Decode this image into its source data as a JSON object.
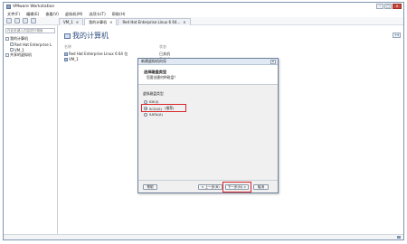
{
  "app": {
    "title": "VMware Workstation"
  },
  "window_controls": {
    "minimize": "–",
    "maximize": "□",
    "close": "x"
  },
  "menu": {
    "items": [
      "文件(F)",
      "编辑(E)",
      "查看(V)",
      "虚拟机(M)",
      "选项卡(T)",
      "帮助(H)"
    ]
  },
  "sidebar": {
    "search_placeholder": "在此处键入内容进行搜索",
    "tree": [
      {
        "label": "我的计算机",
        "level": 0
      },
      {
        "label": "Red Hat Enterprise L",
        "level": 1
      },
      {
        "label": "VM_1",
        "level": 1
      },
      {
        "label": "共享的虚拟机",
        "level": 0
      }
    ]
  },
  "tabs": [
    {
      "label": "VM_1",
      "close": "×"
    },
    {
      "label": "我的计算机",
      "close": "×"
    },
    {
      "label": "Red Hat Enterprise Linux 6 64...",
      "close": "×"
    }
  ],
  "content": {
    "page_title": "我的计算机",
    "plus_button": "+▾",
    "columns": {
      "name": "名称",
      "state": "状态"
    },
    "rows": [
      {
        "name": "Red Hat Enterprise Linux 6 64 位",
        "state": "已关机"
      },
      {
        "name": "VM_1",
        "state": "已关机"
      }
    ]
  },
  "dialog": {
    "title": "新建虚拟机向导",
    "close": "x",
    "heading": "选择磁盘类型",
    "subheading": "您要创建何种磁盘？",
    "group_label": "虚拟磁盘类型",
    "options": [
      {
        "label": "IDE(I)",
        "checked": false
      },
      {
        "label": "SCSI(S)",
        "note": "(推荐)",
        "checked": true
      },
      {
        "label": "SATA(A)",
        "checked": false
      }
    ],
    "buttons": {
      "help": "帮助",
      "back": "< 上一步(B)",
      "next": "下一步(N) >",
      "cancel": "取消"
    }
  },
  "colors": {
    "highlight": "#d9262b",
    "title_blue": "#2f4f7f"
  }
}
